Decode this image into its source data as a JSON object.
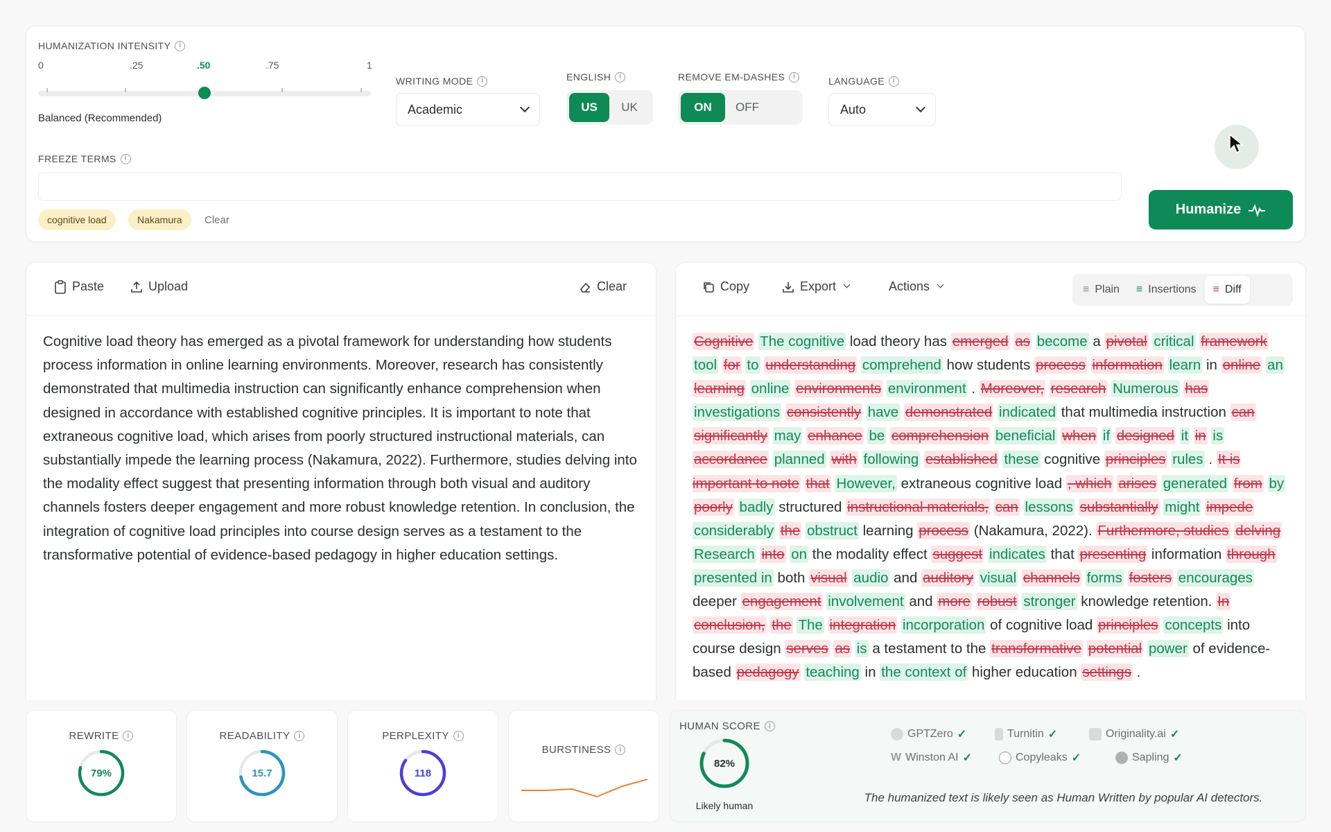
{
  "settings": {
    "intensity_label": "HUMANIZATION INTENSITY",
    "ticks": [
      "0",
      ".25",
      ".50",
      ".75",
      "1"
    ],
    "intensity_value": 0.5,
    "intensity_desc": "Balanced (Recommended)",
    "writing_mode_label": "WRITING MODE",
    "writing_mode_value": "Academic",
    "english_label": "ENGLISH",
    "english_options": [
      "US",
      "UK"
    ],
    "emdash_label": "REMOVE EM-DASHES",
    "emdash_options": [
      "ON",
      "OFF"
    ],
    "language_label": "LANGUAGE",
    "language_value": "Auto",
    "freeze_label": "FREEZE TERMS",
    "freeze_terms": [
      "cognitive load",
      "Nakamura"
    ],
    "clear_label": "Clear",
    "humanize_label": "Humanize"
  },
  "input": {
    "paste_label": "Paste",
    "upload_label": "Upload",
    "clear_label": "Clear",
    "text": "Cognitive load theory has emerged as a pivotal framework for understanding how students process information in online learning environments. Moreover, research has consistently demonstrated that multimedia instruction can significantly enhance comprehension when designed in accordance with established cognitive principles. It is important to note that extraneous cognitive load, which arises from poorly structured instructional materials, can substantially impede the learning process (Nakamura, 2022). Furthermore, studies delving into the modality effect suggest that presenting information through both visual and auditory channels fosters deeper engagement and more robust knowledge retention. In conclusion, the integration of cognitive load principles into course design serves as a testament to the transformative potential of evidence-based pedagogy in higher education settings."
  },
  "output": {
    "copy_label": "Copy",
    "export_label": "Export",
    "actions_label": "Actions",
    "view_options": [
      "Plain",
      "Insertions",
      "Diff"
    ],
    "diff": [
      [
        "d",
        "Cognitive"
      ],
      [
        "i",
        "The cognitive"
      ],
      [
        "n",
        "load theory has"
      ],
      [
        "d",
        "emerged"
      ],
      [
        "d",
        "as"
      ],
      [
        "i",
        "become"
      ],
      [
        "n",
        "a"
      ],
      [
        "d",
        "pivotal"
      ],
      [
        "i",
        "critical"
      ],
      [
        "d",
        "framework"
      ],
      [
        "i",
        "tool"
      ],
      [
        "d",
        "for"
      ],
      [
        "i",
        "to"
      ],
      [
        "d",
        "understanding"
      ],
      [
        "i",
        "comprehend"
      ],
      [
        "n",
        "how students"
      ],
      [
        "d",
        "process"
      ],
      [
        "d",
        "information"
      ],
      [
        "i",
        "learn"
      ],
      [
        "n",
        "in"
      ],
      [
        "d",
        "online"
      ],
      [
        "i",
        "an"
      ],
      [
        "d",
        "learning"
      ],
      [
        "i",
        "online"
      ],
      [
        "d",
        "environments"
      ],
      [
        "i",
        "environment"
      ],
      [
        "n",
        "."
      ],
      [
        "d",
        "Moreover,"
      ],
      [
        "d",
        "research"
      ],
      [
        "i",
        "Numerous"
      ],
      [
        "d",
        "has"
      ],
      [
        "i",
        "investigations"
      ],
      [
        "d",
        "consistently"
      ],
      [
        "i",
        "have"
      ],
      [
        "d",
        "demonstrated"
      ],
      [
        "i",
        "indicated"
      ],
      [
        "n",
        "that"
      ],
      [
        "n",
        "multimedia instruction"
      ],
      [
        "d",
        "can"
      ],
      [
        "d",
        "significantly"
      ],
      [
        "i",
        "may"
      ],
      [
        "d",
        "enhance"
      ],
      [
        "i",
        "be"
      ],
      [
        "d",
        "comprehension"
      ],
      [
        "i",
        "beneficial"
      ],
      [
        "d",
        "when"
      ],
      [
        "i",
        "if"
      ],
      [
        "d",
        "designed"
      ],
      [
        "i",
        "it"
      ],
      [
        "d",
        "in"
      ],
      [
        "i",
        "is"
      ],
      [
        "d",
        "accordance"
      ],
      [
        "i",
        "planned"
      ],
      [
        "d",
        "with"
      ],
      [
        "i",
        "following"
      ],
      [
        "d",
        "established"
      ],
      [
        "i",
        "these"
      ],
      [
        "n",
        "cognitive"
      ],
      [
        "d",
        "principles"
      ],
      [
        "i",
        "rules"
      ],
      [
        "n",
        "."
      ],
      [
        "d",
        "It is important to note"
      ],
      [
        "d",
        "that"
      ],
      [
        "i",
        "However,"
      ],
      [
        "n",
        "extraneous cognitive"
      ],
      [
        "n",
        "load"
      ],
      [
        "d",
        ", which"
      ],
      [
        "d",
        "arises"
      ],
      [
        "i",
        "generated"
      ],
      [
        "d",
        "from"
      ],
      [
        "i",
        "by"
      ],
      [
        "d",
        "poorly"
      ],
      [
        "i",
        "badly"
      ],
      [
        "n",
        "structured"
      ],
      [
        "d",
        "instructional materials,"
      ],
      [
        "d",
        "can"
      ],
      [
        "i",
        "lessons"
      ],
      [
        "d",
        "substantially"
      ],
      [
        "i",
        "might"
      ],
      [
        "d",
        "impede"
      ],
      [
        "i",
        "considerably"
      ],
      [
        "d",
        "the"
      ],
      [
        "i",
        "obstruct"
      ],
      [
        "n",
        "learning"
      ],
      [
        "d",
        "process"
      ],
      [
        "n",
        "(Nakamura, 2022)."
      ],
      [
        "d",
        "Furthermore, studies"
      ],
      [
        "d",
        "delving"
      ],
      [
        "i",
        "Research"
      ],
      [
        "d",
        "into"
      ],
      [
        "i",
        "on"
      ],
      [
        "n",
        "the modality effect"
      ],
      [
        "d",
        "suggest"
      ],
      [
        "i",
        "indicates"
      ],
      [
        "n",
        "that"
      ],
      [
        "d",
        "presenting"
      ],
      [
        "n",
        "information"
      ],
      [
        "d",
        "through"
      ],
      [
        "i",
        "presented in"
      ],
      [
        "n",
        "both"
      ],
      [
        "d",
        "visual"
      ],
      [
        "i",
        "audio"
      ],
      [
        "n",
        "and"
      ],
      [
        "d",
        "auditory"
      ],
      [
        "i",
        "visual"
      ],
      [
        "d",
        "channels"
      ],
      [
        "i",
        "forms"
      ],
      [
        "d",
        "fosters"
      ],
      [
        "i",
        "encourages"
      ],
      [
        "n",
        "deeper"
      ],
      [
        "d",
        "engagement"
      ],
      [
        "i",
        "involvement"
      ],
      [
        "n",
        "and"
      ],
      [
        "d",
        "more"
      ],
      [
        "d",
        "robust"
      ],
      [
        "i",
        "stronger"
      ],
      [
        "n",
        "knowledge retention."
      ],
      [
        "d",
        "In"
      ],
      [
        "d",
        "conclusion,"
      ],
      [
        "d",
        "the"
      ],
      [
        "i",
        "The"
      ],
      [
        "d",
        "integration"
      ],
      [
        "i",
        "incorporation"
      ],
      [
        "n",
        "of cognitive load"
      ],
      [
        "d",
        "principles"
      ],
      [
        "i",
        "concepts"
      ],
      [
        "n",
        "into course design"
      ],
      [
        "d",
        "serves"
      ],
      [
        "d",
        "as"
      ],
      [
        "i",
        "is"
      ],
      [
        "n",
        "a testament to the"
      ],
      [
        "d",
        "transformative"
      ],
      [
        "d",
        "potential"
      ],
      [
        "i",
        "power"
      ],
      [
        "n",
        "of"
      ],
      [
        "n",
        "evidence-based"
      ],
      [
        "d",
        "pedagogy"
      ],
      [
        "i",
        "teaching"
      ],
      [
        "n",
        "in"
      ],
      [
        "i",
        "the context of"
      ],
      [
        "n",
        "higher education"
      ],
      [
        "d",
        "settings"
      ],
      [
        "n",
        "."
      ]
    ]
  },
  "metrics": {
    "rewrite": {
      "label": "REWRITE",
      "value": "79%",
      "pct": 0.79,
      "color": "#11895a"
    },
    "readability": {
      "label": "READABILITY",
      "value": "15.7",
      "pct": 0.72,
      "color": "#2a93c2"
    },
    "perplexity": {
      "label": "PERPLEXITY",
      "value": "118",
      "pct": 0.85,
      "color": "#4a3fd6"
    },
    "burstiness": {
      "label": "BURSTINESS",
      "color": "#e9822f",
      "series": [
        0.3,
        0.3,
        0.34,
        0.12,
        0.42,
        0.62
      ]
    }
  },
  "human_score": {
    "label": "HUMAN SCORE",
    "value": "82%",
    "pct": 0.82,
    "verdict": "Likely human",
    "detectors": [
      "GPTZero",
      "Turnitin",
      "Originality.ai",
      "Winston AI",
      "Copyleaks",
      "Sapling"
    ],
    "message": "The humanized text is likely seen as Human Written by popular AI detectors."
  }
}
